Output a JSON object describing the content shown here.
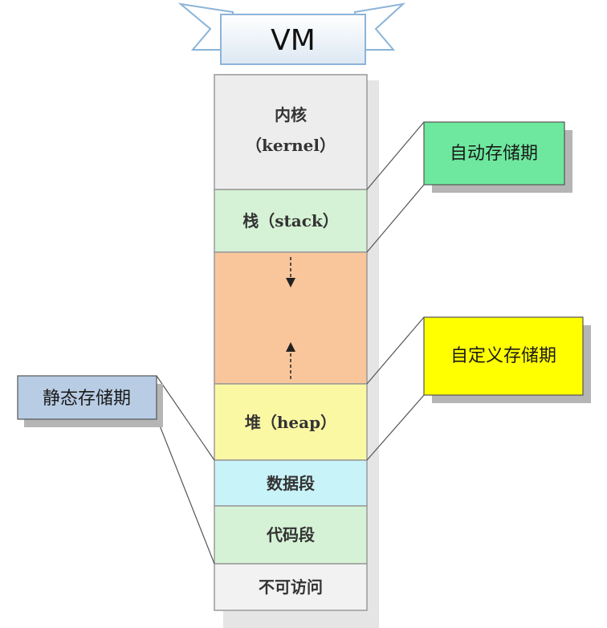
{
  "title": "VM",
  "segments": [
    {
      "id": "kernel",
      "line1": "内核",
      "line2": "（kernel）",
      "fill": "#ededed"
    },
    {
      "id": "stack",
      "line1": "栈（stack）",
      "fill": "#d6f2d6"
    },
    {
      "id": "free",
      "fill": "#f9c69b"
    },
    {
      "id": "heap",
      "line1": "堆（heap）",
      "fill": "#fbf8a4"
    },
    {
      "id": "data",
      "line1": "数据段",
      "fill": "#c8f3f8"
    },
    {
      "id": "code",
      "line1": "代码段",
      "fill": "#d6f2d6"
    },
    {
      "id": "forbidden",
      "line1": "不可访问",
      "fill": "#f2f2f2"
    }
  ],
  "callouts": {
    "automatic": {
      "label": "自动存储期",
      "fill": "#6ee89e"
    },
    "custom": {
      "label": "自定义存储期",
      "fill": "#ffff00"
    },
    "static": {
      "label": "静态存储期",
      "fill": "#b8cce4"
    }
  }
}
